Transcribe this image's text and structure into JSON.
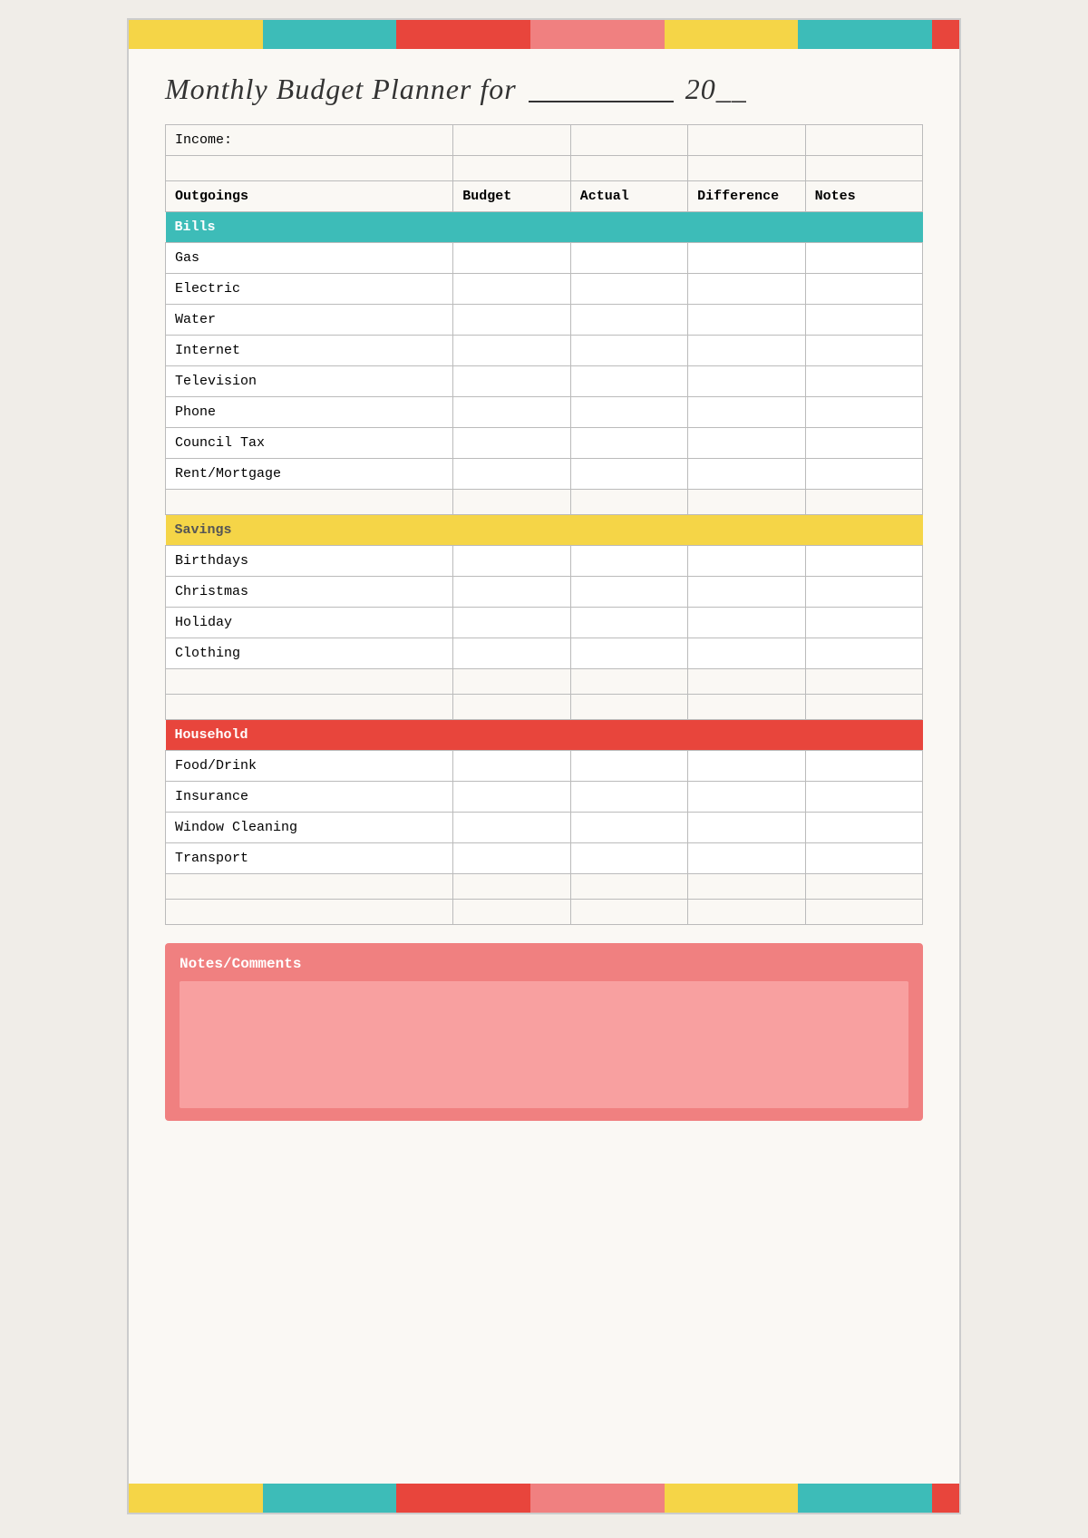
{
  "title": {
    "prefix": "Monthly Budget Planner for",
    "year_prefix": "20"
  },
  "table": {
    "income_label": "Income:",
    "headers": {
      "outgoings": "Outgoings",
      "budget": "Budget",
      "actual": "Actual",
      "difference": "Difference",
      "notes": "Notes"
    },
    "sections": {
      "bills": {
        "label": "Bills",
        "rows": [
          "Gas",
          "Electric",
          "Water",
          "Internet",
          "Television",
          "Phone",
          "Council Tax",
          "Rent/Mortgage"
        ]
      },
      "savings": {
        "label": "Savings",
        "rows": [
          "Birthdays",
          "Christmas",
          "Holiday",
          "Clothing"
        ]
      },
      "household": {
        "label": "Household",
        "rows": [
          "Food/Drink",
          "Insurance",
          "Window Cleaning",
          "Transport"
        ]
      }
    }
  },
  "notes": {
    "label": "Notes/Comments"
  },
  "colors": {
    "teal": "#3dbcb8",
    "yellow": "#f5d547",
    "red": "#e8453c",
    "pink": "#f08080"
  }
}
